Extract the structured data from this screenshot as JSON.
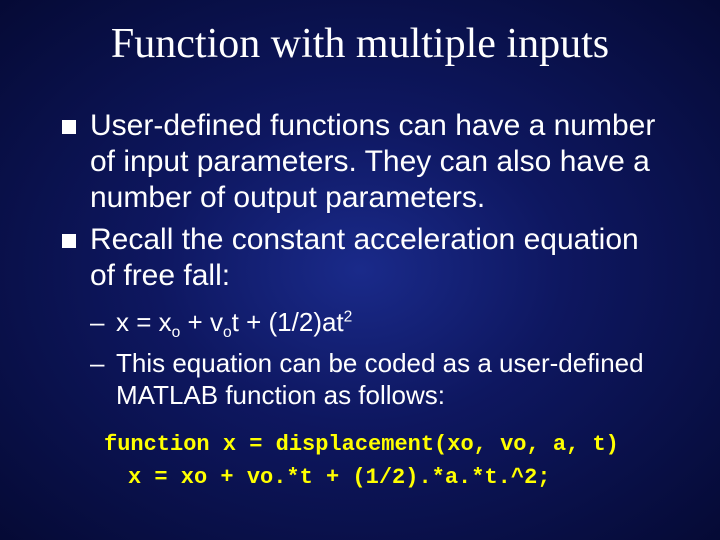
{
  "title": "Function with multiple inputs",
  "bullets": [
    "User-defined functions can have a number of input parameters. They can also have a number of output parameters.",
    "Recall the constant acceleration equation of free fall:"
  ],
  "sub": {
    "eq_pre": "x = x",
    "eq_sub1": "o",
    "eq_mid1": " + v",
    "eq_sub2": "o",
    "eq_mid2": "t + (1/2)at",
    "eq_sup": "2",
    "line2": "This equation can be coded as a user-defined MATLAB function as follows:"
  },
  "code": {
    "line1": "function x = displacement(xo, vo, a, t)",
    "line2": "x = xo + vo.*t + (1/2).*a.*t.^2;"
  }
}
